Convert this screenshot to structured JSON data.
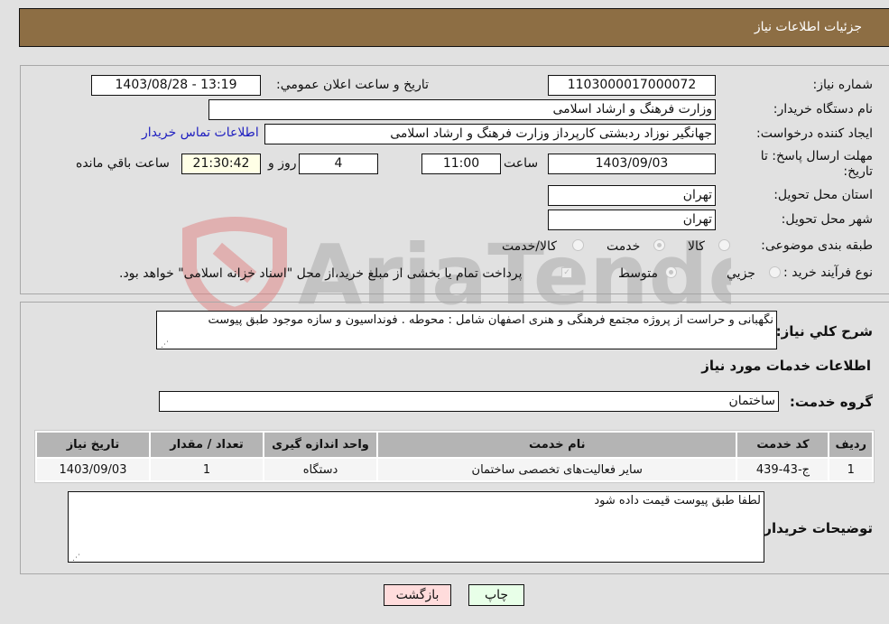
{
  "header": {
    "title": "جزئیات اطلاعات نیاز"
  },
  "form": {
    "need_number": {
      "label": "شماره نیاز:",
      "value": "1103000017000072"
    },
    "announce_datetime": {
      "label": "تاریخ و ساعت اعلان عمومي:",
      "value": "1403/08/28 - 13:19"
    },
    "buyer_org": {
      "label": "نام دستگاه خریدار:",
      "value": "وزارت فرهنگ و ارشاد اسلامی"
    },
    "requester": {
      "label": "ایجاد کننده درخواست:",
      "value": "جهانگیر نوزاد ردبشتی کارپرداز وزارت فرهنگ و ارشاد اسلامی"
    },
    "buyer_contact_link": "اطلاعات تماس خریدار",
    "deadline": {
      "label_line1": "مهلت ارسال پاسخ: تا",
      "label_line2": "تاریخ:",
      "date": "1403/09/03",
      "time_label": "ساعت",
      "time": "11:00",
      "days": "4",
      "days_label": "روز و",
      "remaining": "21:30:42",
      "remaining_label": "ساعت باقي مانده"
    },
    "province": {
      "label": "استان محل تحویل:",
      "value": "تهران"
    },
    "city": {
      "label": "شهر محل تحویل:",
      "value": "تهران"
    },
    "category": {
      "label": "طبقه بندی موضوعی:",
      "options": [
        {
          "label": "کالا",
          "checked": false
        },
        {
          "label": "خدمت",
          "checked": true
        },
        {
          "label": "کالا/خدمت",
          "checked": false
        }
      ]
    },
    "purchase_type": {
      "label": "نوع فرآیند خرید :",
      "options": [
        {
          "label": "جزيي",
          "checked": false
        },
        {
          "label": "متوسط",
          "checked": true
        }
      ],
      "treasury_note": "پرداخت تمام یا بخشی از مبلغ خرید،از محل \"اسناد خزانه اسلامی\" خواهد بود."
    }
  },
  "description": {
    "label": "شرح کلي نیاز:",
    "value": "نگهبانی و حراست از پروژه مجتمع فرهنگی و هنری اصفهان  شامل : محوطه  . فونداسیون و سازه موجود طبق پیوست"
  },
  "services_section": {
    "title": "اطلاعات خدمات مورد نیاز"
  },
  "service_group": {
    "label": "گروه خدمت:",
    "value": "ساختمان"
  },
  "table": {
    "headers": [
      "ردیف",
      "کد خدمت",
      "نام خدمت",
      "واحد اندازه گیری",
      "تعداد / مقدار",
      "تاریخ نیاز"
    ],
    "rows": [
      [
        "1",
        "ج-43-439",
        "سایر فعالیت‌های تخصصی ساختمان",
        "دستگاه",
        "1",
        "1403/09/03"
      ]
    ]
  },
  "buyer_notes": {
    "label": "توضیحات خریدار:",
    "value": "لطفا طبق پیوست قیمت داده شود"
  },
  "buttons": {
    "print": "چاپ",
    "back": "بازگشت"
  },
  "watermark": "AriaTender.neT"
}
